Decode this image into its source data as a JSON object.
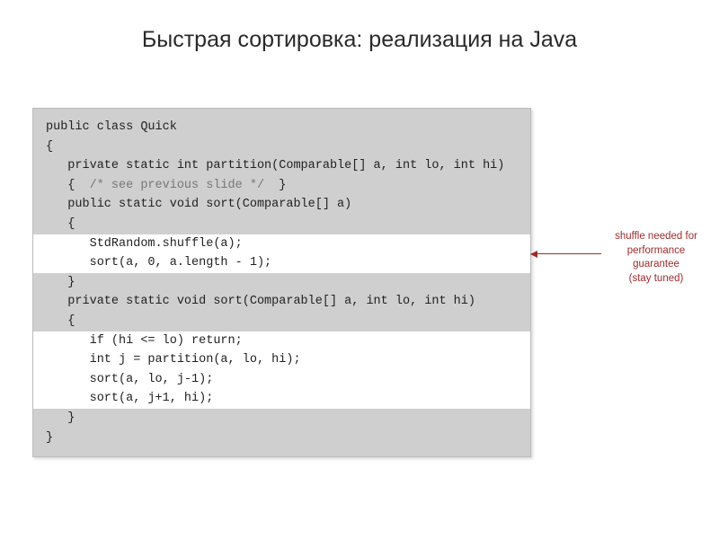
{
  "title": "Быстрая сортировка: реализация на Java",
  "code": {
    "l0": "public class Quick",
    "l1": "{",
    "l2": "   private static int partition(Comparable[] a, int lo, int hi)",
    "l3a": "   {  ",
    "l3b": "/* see previous slide */",
    "l3c": "  }",
    "l4": "",
    "l5": "   public static void sort(Comparable[] a)",
    "l6": "   {",
    "l7": "      StdRandom.shuffle(a);",
    "l8": "      sort(a, 0, a.length - 1);",
    "l9": "   }",
    "l10": "",
    "l11": "   private static void sort(Comparable[] a, int lo, int hi)",
    "l12": "   {",
    "l13": "      if (hi <= lo) return;",
    "l14": "      int j = partition(a, lo, hi);",
    "l15": "      sort(a, lo, j-1);",
    "l16": "      sort(a, j+1, hi);",
    "l17": "   }",
    "l18": "}"
  },
  "annotation": {
    "line1": "shuffle needed for",
    "line2": "performance guarantee",
    "line3": "(stay tuned)"
  }
}
